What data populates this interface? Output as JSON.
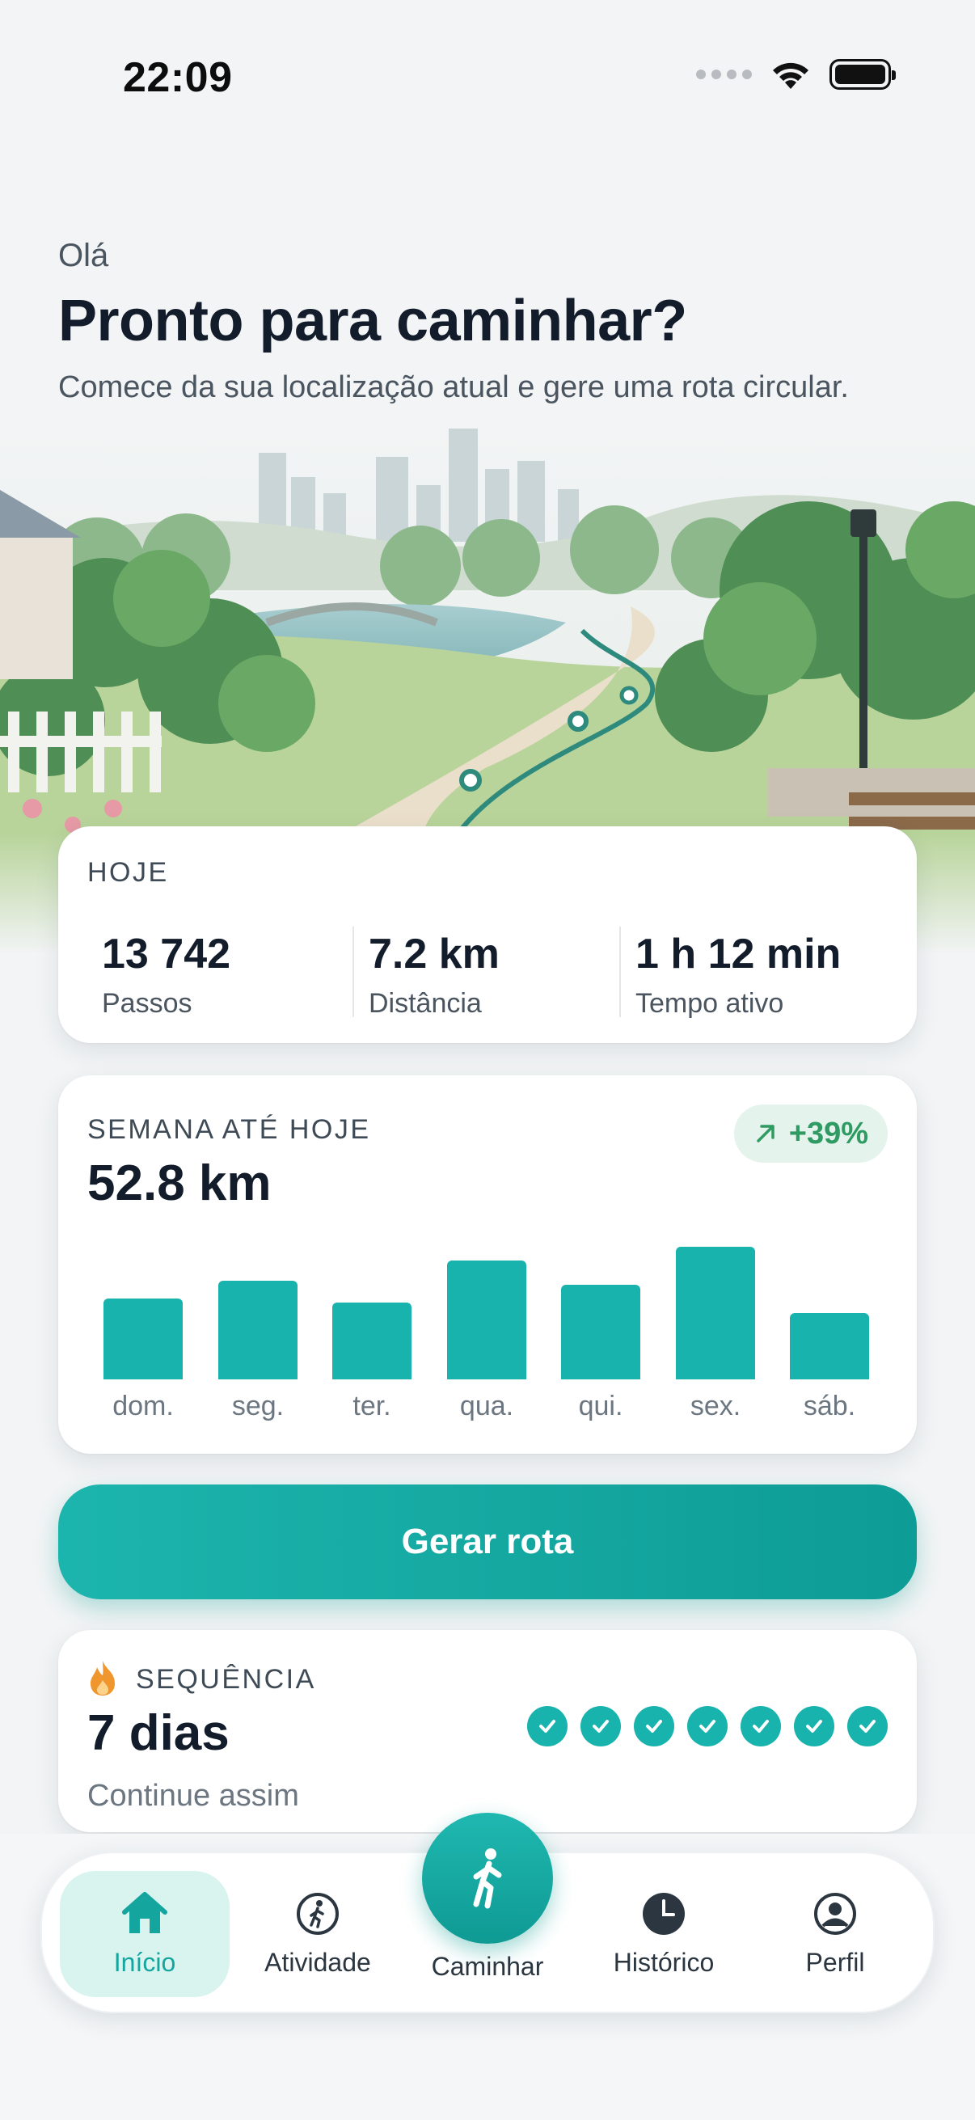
{
  "status_bar": {
    "time": "22:09"
  },
  "header": {
    "greeting": "Olá",
    "title": "Pronto para caminhar?",
    "subtitle": "Comece da sua localização atual e gere uma rota circular."
  },
  "hero": {
    "image_icon": "park-path-illustration"
  },
  "today": {
    "label": "HOJE",
    "stats": [
      {
        "value": "13 742",
        "label": "Passos"
      },
      {
        "value": "7.2 km",
        "label": "Distância"
      },
      {
        "value": "1 h 12 min",
        "label": "Tempo ativo"
      }
    ]
  },
  "week": {
    "label": "SEMANA ATÉ HOJE",
    "total": "52.8 km",
    "trend": "+39%",
    "trend_icon": "arrow-up-right-icon"
  },
  "chart_data": {
    "type": "bar",
    "categories": [
      "dom.",
      "seg.",
      "ter.",
      "qua.",
      "qui.",
      "sex.",
      "sáb."
    ],
    "values": [
      6.0,
      7.3,
      5.7,
      8.8,
      7.0,
      9.8,
      4.9
    ],
    "title": "",
    "xlabel": "",
    "ylabel": ""
  },
  "cta": {
    "label": "Gerar rota"
  },
  "streak": {
    "label": "SEQUÊNCIA",
    "value": "7 dias",
    "subtitle": "Continue assim",
    "icon": "flame-icon",
    "days_completed": 7
  },
  "tabs": [
    {
      "label": "Início",
      "icon": "home-icon",
      "active": true
    },
    {
      "label": "Atividade",
      "icon": "walker-icon",
      "active": false
    },
    {
      "label": "Caminhar",
      "icon": "walking-person-icon",
      "active": false
    },
    {
      "label": "Histórico",
      "icon": "clock-icon",
      "active": false
    },
    {
      "label": "Perfil",
      "icon": "profile-icon",
      "active": false
    }
  ],
  "colors": {
    "accent": "#18b3ad",
    "trend_bg": "#e4f3ec",
    "trend_fg": "#2f9a62",
    "streak_flame": "#f0962f"
  }
}
